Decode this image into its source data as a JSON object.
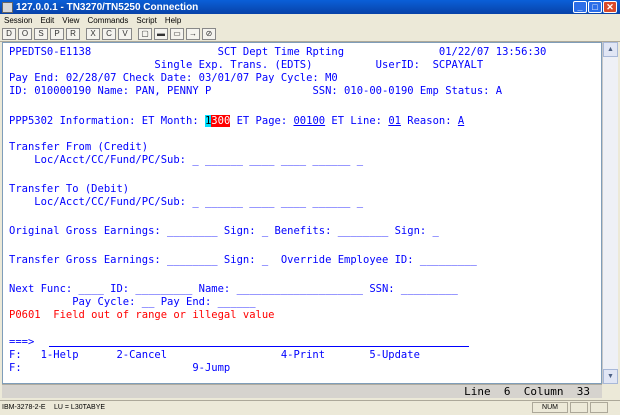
{
  "window": {
    "title": "127.0.0.1 - TN3270/TN5250 Connection",
    "min_glyph": "_",
    "max_glyph": "□",
    "close_glyph": "✕"
  },
  "menu": [
    "Session",
    "Edit",
    "View",
    "Commands",
    "Script",
    "Help"
  ],
  "toolbar": [
    "D",
    "O",
    "S",
    "P",
    "R",
    "X",
    "C",
    "V",
    "▢",
    "▬",
    "▭",
    "→",
    "⊘"
  ],
  "terminal": {
    "l1_left": "PPEDTS0-E1138",
    "l1_mid": "SCT Dept Time Rpting",
    "l1_right": "01/22/07 13:56:30",
    "l2_mid": "Single Exp. Trans. (EDTS)",
    "l2_right": "UserID:  SCPAYALT",
    "l3": "Pay End: 02/28/07 Check Date: 03/01/07 Pay Cycle: M0",
    "l4_left": "ID: 010000190 Name: PAN, PENNY P",
    "l4_right": "SSN: 010-00-0190 Emp Status: A",
    "info_label": "PPP5302 Information: ET Month: ",
    "et_month_cursor": "1",
    "et_month_rest": "300",
    "et_page_label": " ET Page: ",
    "et_page": "00100",
    "et_line_label": " ET Line: ",
    "et_line": "01",
    "reason_label": " Reason: ",
    "reason": "A",
    "transfer_from": "Transfer From (Credit)",
    "loc_label": "    Loc/Acct/CC/Fund/PC/Sub: ",
    "loc_fields": "_ ______ ____ ____ ______ _",
    "transfer_to": "Transfer To (Debit)",
    "orig_gross": "Original Gross Earnings: ________ Sign: _ Benefits: ________ Sign: _",
    "transfer_gross": "Transfer Gross Earnings: ________ Sign: _  Override Employee ID: _________",
    "next_func": "Next Func: ____ ID: _________ Name: ____________________ SSN: _________",
    "pay_cycle": "          Pay Cycle: __ Pay End: ______",
    "error_msg": "P0601  Field out of range or illegal value",
    "prompt": "===>",
    "fkeys1": "F:   1-Help      2-Cancel                  4-Print       5-Update",
    "fkeys2": "F:                           9-Jump"
  },
  "position": {
    "line_label": "Line",
    "line": "6",
    "column_label": "Column",
    "column": "33"
  },
  "status": {
    "terminal_type": "IBM-3278-2-E",
    "lu": "LU = L30TABYE",
    "num_lock": "NUM"
  }
}
